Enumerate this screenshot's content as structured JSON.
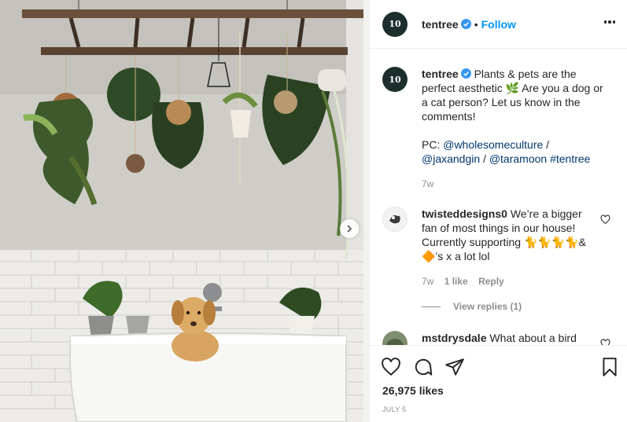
{
  "post": {
    "account": {
      "username": "tentree",
      "avatar_text": "10",
      "verified": true,
      "follow_label": "Follow",
      "separator": "•"
    },
    "caption": {
      "username": "tentree",
      "line1": "Plants & pets are the perfect aesthetic 🌿 Are you a dog or a cat person? Let us know in the comments!",
      "pc_label": "PC:",
      "mention1": "@wholesomeculture",
      "slash1": "/",
      "mention2": "@jaxandgin",
      "slash2": "/",
      "mention3": "@taramoon",
      "hashtag": "#tentree",
      "time": "7w"
    },
    "comments": [
      {
        "username": "twisteddesigns0",
        "text": "We’re a bigger fan of most things in our house! Currently supporting 🐈🐈🐈🐈& 🔶’s x a lot lol",
        "time": "7w",
        "likes": "1 like",
        "reply_label": "Reply",
        "view_replies": "View replies (1)"
      },
      {
        "username": "mstdrysdale",
        "text": "What about a bird"
      }
    ],
    "likes": "26,975 likes",
    "date": "JULY 5"
  },
  "colors": {
    "accent_blue": "#0095f6",
    "link_blue": "#00376b",
    "avatar_bg": "#1d2f2d",
    "muted": "#8e8e8e"
  },
  "icons": [
    "verified-badge-icon",
    "more-options-icon",
    "heart-icon",
    "comment-icon",
    "share-icon",
    "bookmark-icon",
    "chevron-right-icon"
  ]
}
